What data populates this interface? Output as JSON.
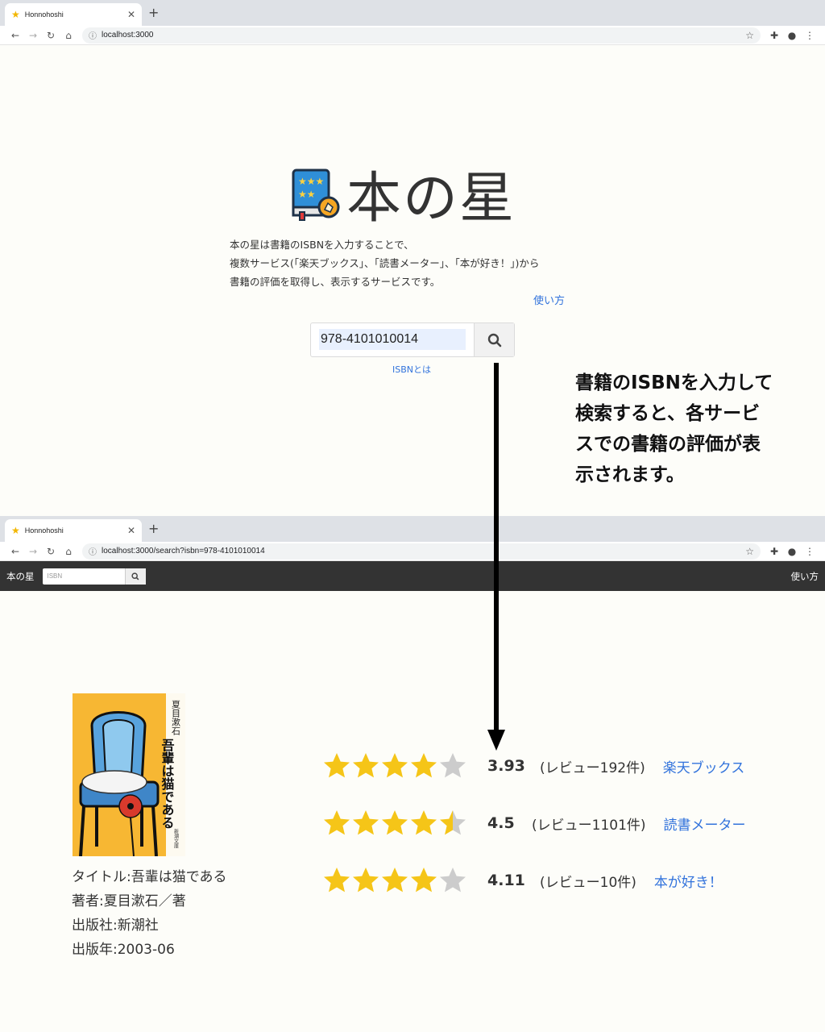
{
  "browser_top": {
    "tab_title": "Honnohoshi",
    "url": "localhost:3000"
  },
  "home": {
    "logo_text": "本の星",
    "description": [
      "本の星は書籍のISBNを入力することで、",
      "複数サービス(「楽天ブックス」、「読書メーター」、「本が好き！」)から",
      "書籍の評価を取得し、表示するサービスです。"
    ],
    "usage_link": "使い方",
    "search_value": "978-4101010014",
    "isbn_help_link": "ISBNとは"
  },
  "callout": {
    "lines": [
      "書籍のISBNを入力して",
      "検索すると、各サービ",
      "スでの書籍の評価が表",
      "示されます。"
    ]
  },
  "browser_bottom": {
    "tab_title": "Honnohoshi",
    "url": "localhost:3000/search?isbn=978-4101010014"
  },
  "navbar": {
    "brand": "本の星",
    "search_placeholder": "ISBN",
    "usage_link": "使い方"
  },
  "book": {
    "cover_author_vertical": "夏目漱石",
    "cover_title_vertical": "吾輩は猫である",
    "cover_publisher_vertical": "新潮文庫",
    "title_line": "タイトル:吾輩は猫である",
    "author_line": "著者:夏目漱石／著",
    "publisher_line": "出版社:新潮社",
    "published_line": "出版年:2003-06"
  },
  "ratings": [
    {
      "stars": 3.93,
      "score": "3.93",
      "reviews": "(レビュー192件)",
      "service": "楽天ブックス"
    },
    {
      "stars": 4.5,
      "score": "4.5",
      "reviews": "(レビュー1101件)",
      "service": "読書メーター"
    },
    {
      "stars": 4.11,
      "score": "4.11",
      "reviews": "(レビュー10件)",
      "service": "本が好き！"
    }
  ],
  "colors": {
    "link": "#3273dc",
    "star_filled": "#f5c518",
    "star_empty": "#cccccc",
    "navbar_bg": "#333333"
  }
}
